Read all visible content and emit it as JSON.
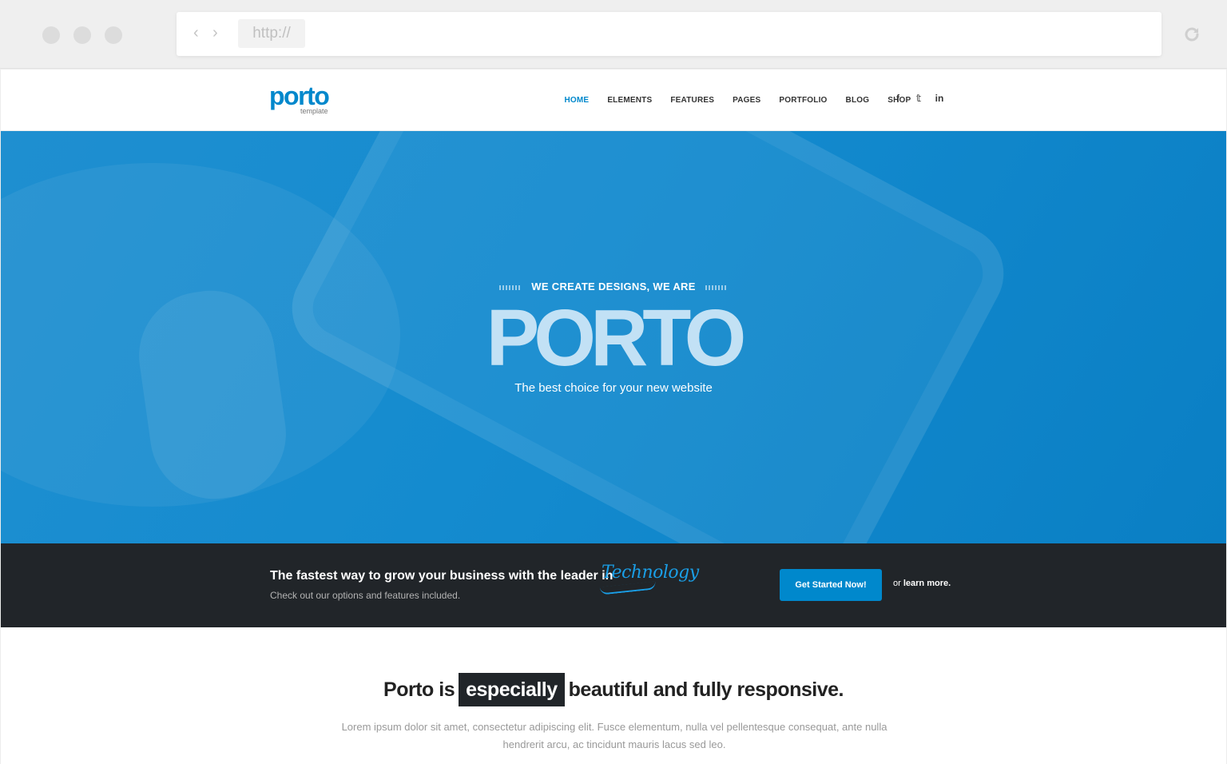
{
  "browser": {
    "url": "http://",
    "back_glyph": "‹",
    "forward_glyph": "›",
    "icons": [
      "chevron-left-icon",
      "chevron-right-icon",
      "reload-icon"
    ]
  },
  "header": {
    "logo_word": "porto",
    "logo_sub": "template",
    "menu": [
      "HOME",
      "ELEMENTS",
      "FEATURES",
      "PAGES",
      "PORTFOLIO",
      "BLOG",
      "SHOP"
    ],
    "active_menu": "HOME",
    "social": [
      {
        "name": "facebook-icon",
        "glyph": "f"
      },
      {
        "name": "twitter-icon",
        "glyph": "𝕥"
      },
      {
        "name": "linkedin-icon",
        "glyph": "in"
      }
    ]
  },
  "hero": {
    "kicker": "WE CREATE DESIGNS, WE ARE",
    "title": "PORTO",
    "subtitle": "The best choice for your new website"
  },
  "cta": {
    "headline": "The fastest way to grow your business with the leader in",
    "script_word": "Technology",
    "subline": "Check out our options and features included.",
    "button": "Get Started Now!",
    "or_text": "or",
    "learn_more": "learn more."
  },
  "intro": {
    "title_before": "Porto is",
    "title_highlight": "especially",
    "title_after": "beautiful and fully responsive.",
    "paragraph": "Lorem ipsum dolor sit amet, consectetur adipiscing elit. Fusce elementum, nulla vel pellentesque consequat, ante nulla hendrerit arcu, ac tincidunt mauris lacus sed leo."
  },
  "colors": {
    "primary": "#0088cc",
    "dark": "#212529",
    "hero": "#148bcf"
  }
}
